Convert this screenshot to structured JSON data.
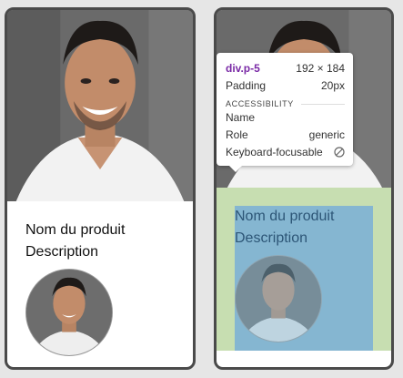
{
  "cards": [
    {
      "title": "Nom du produit",
      "description": "Description"
    },
    {
      "title": "Nom du produit",
      "description": "Description"
    }
  ],
  "tooltip": {
    "selector": "div.p-5",
    "dimensions": "192 × 184",
    "padding_label": "Padding",
    "padding_value": "20px",
    "accessibility_heading": "ACCESSIBILITY",
    "name_label": "Name",
    "role_label": "Role",
    "role_value": "generic",
    "keyboard_label": "Keyboard-focusable",
    "keyboard_icon": "not-allowed-icon"
  },
  "colors": {
    "selector": "#7a2aa6",
    "padding_highlight": "#c7deb1",
    "content_highlight": "#6fa8dc"
  }
}
